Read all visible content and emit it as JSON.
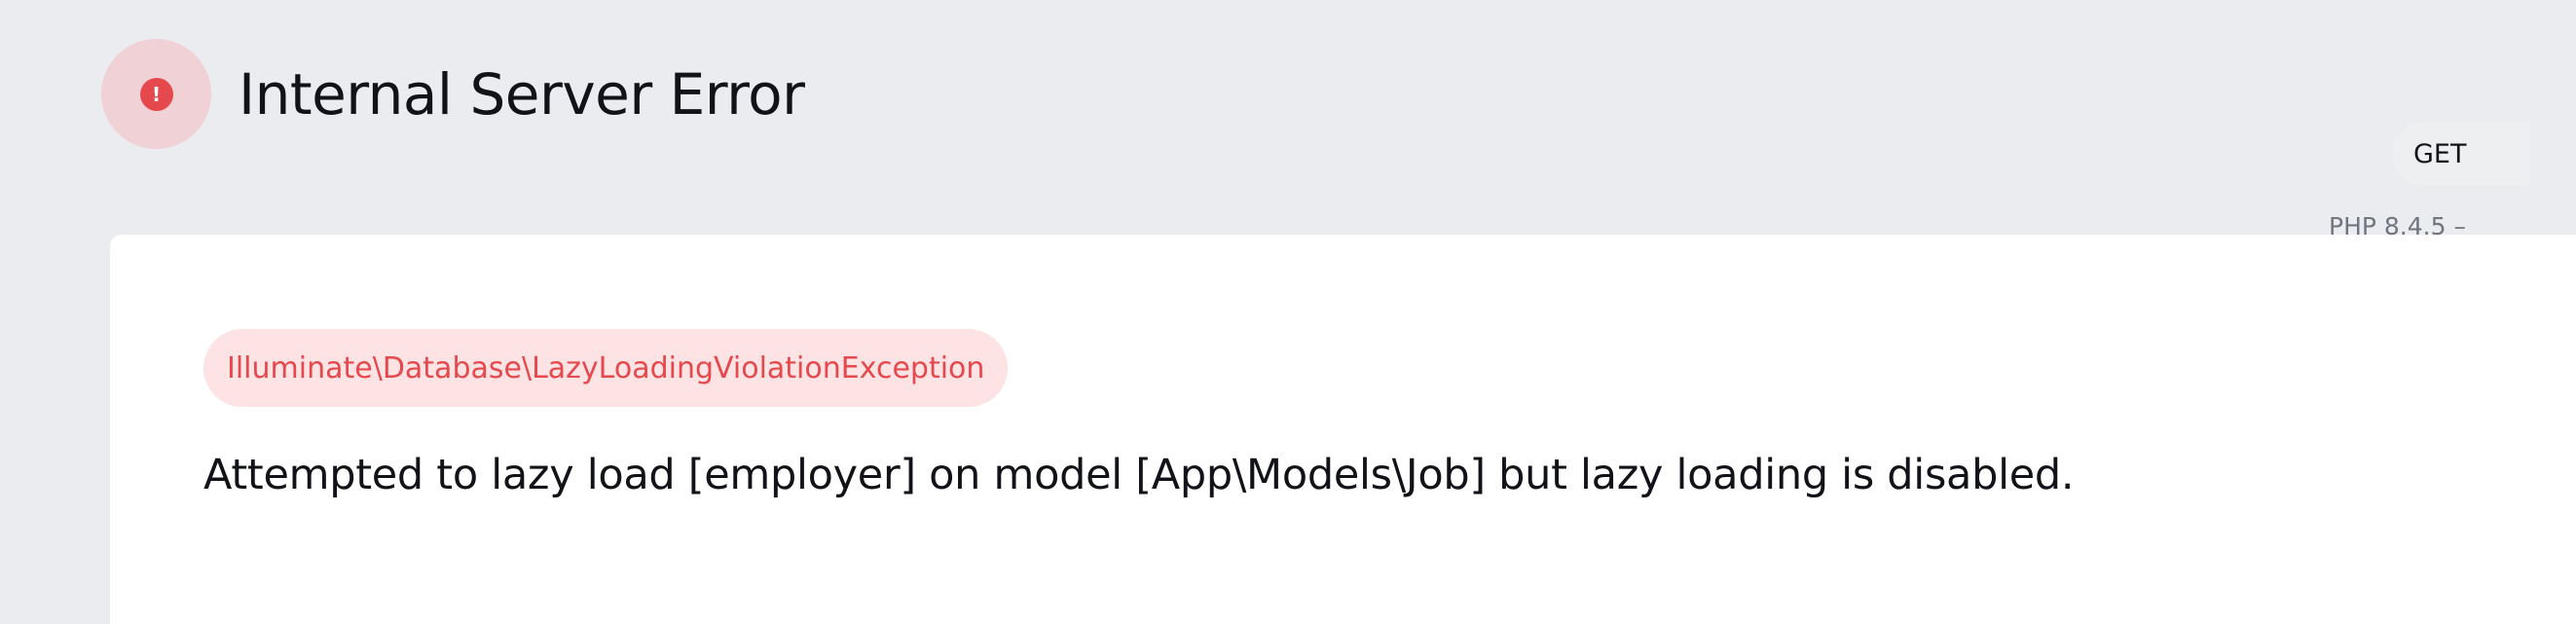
{
  "header": {
    "icon": "exclamation-icon",
    "icon_glyph": "!",
    "title": "Internal Server Error"
  },
  "exception": {
    "class_name": "Illuminate\\Database\\LazyLoadingViolationException",
    "message": "Attempted to lazy load [employer] on model [App\\Models\\Job] but lazy loading is disabled."
  },
  "request": {
    "method": "GET",
    "php_version": "PHP 8.4.5 –"
  },
  "colors": {
    "background": "#ebecef",
    "card": "#ffffff",
    "error_accent": "#e5484d",
    "error_badge_bg": "#fde3e3",
    "icon_halo": "#efd1d6"
  }
}
